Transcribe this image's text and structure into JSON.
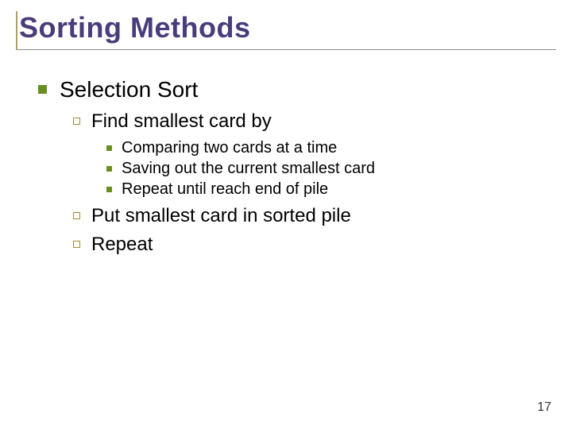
{
  "title": "Sorting Methods",
  "body": [
    {
      "text": "Selection Sort",
      "children": [
        {
          "text": "Find smallest card by",
          "children": [
            {
              "text": "Comparing two cards at a time"
            },
            {
              "text": "Saving out the current smallest card"
            },
            {
              "text": "Repeat until reach end of pile"
            }
          ]
        },
        {
          "text": "Put smallest card in sorted pile"
        },
        {
          "text": "Repeat"
        }
      ]
    }
  ],
  "page_number": "17",
  "colors": {
    "title": "#4a3c7a",
    "bullet_filled": "#6b8e23",
    "bullet_hollow_border": "#a08a3a"
  }
}
